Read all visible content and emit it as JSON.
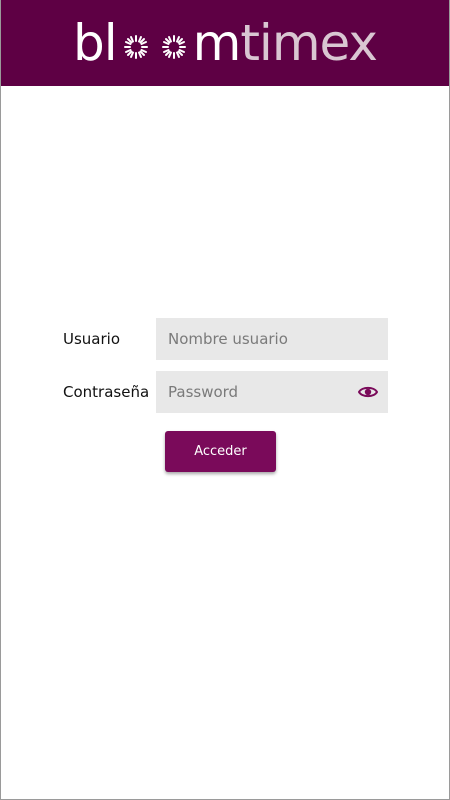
{
  "brand": {
    "logo_prefix": "bl",
    "logo_suffix_bold": "m",
    "logo_suffix_light": "timex",
    "logo_full": "bloomtimex",
    "header_color": "#5e0044",
    "accent_color": "#7a0a5a"
  },
  "login": {
    "username_label": "Usuario",
    "username_placeholder": "Nombre usuario",
    "username_value": "",
    "password_label": "Contraseña",
    "password_placeholder": "Password",
    "password_value": "",
    "show_password_icon": "eye-icon",
    "submit_label": "Acceder"
  }
}
